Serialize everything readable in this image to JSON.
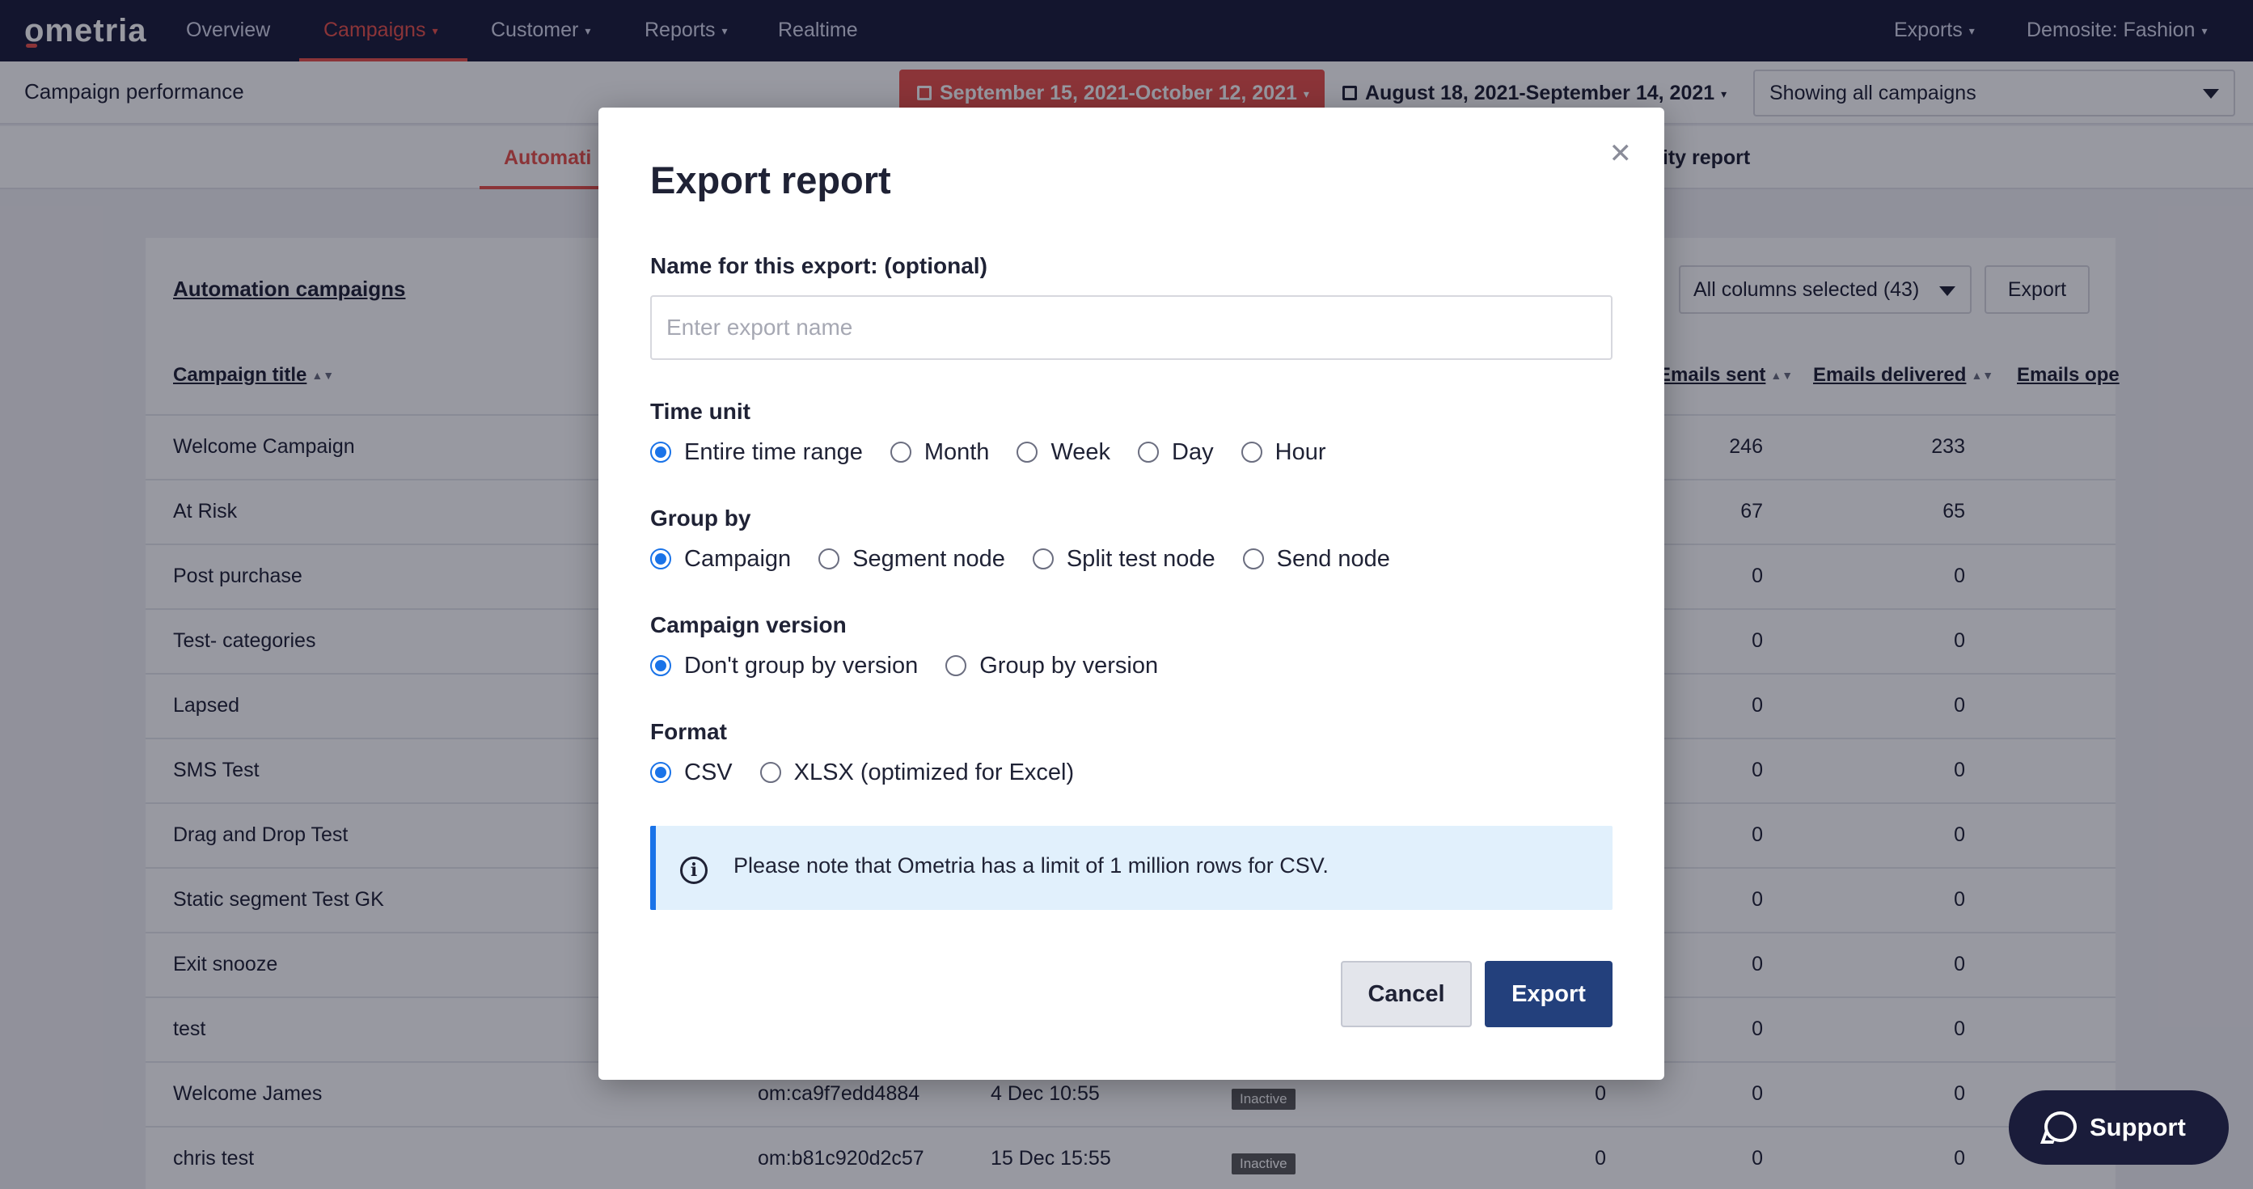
{
  "brand": {
    "logo": "ometria",
    "accent": "#e8524a",
    "nav_bg": "#1a1c3a",
    "primary_button": "#23407c"
  },
  "nav": {
    "items": [
      {
        "label": "Overview"
      },
      {
        "label": "Campaigns",
        "active": true
      },
      {
        "label": "Customer"
      },
      {
        "label": "Reports"
      },
      {
        "label": "Realtime"
      }
    ],
    "right": {
      "exports": "Exports",
      "account": "Demosite: Fashion"
    }
  },
  "subheader": {
    "title": "Campaign performance",
    "date_range_primary": "September 15, 2021-October 12, 2021",
    "date_range_compare": "August 18, 2021-September 14, 2021",
    "campaign_filter": "Showing all campaigns"
  },
  "tabs": {
    "left": "Automati",
    "right": "ility report"
  },
  "table": {
    "title": "Automation campaigns",
    "columns_select": "All columns selected (43)",
    "export_label": "Export",
    "headers": {
      "campaign_title": "Campaign title",
      "emails_sent": "Emails sent",
      "emails_delivered": "Emails delivered",
      "emails_opened": "Emails ope"
    },
    "rows": [
      {
        "title": "Welcome Campaign",
        "sent": "246",
        "delivered": "233"
      },
      {
        "title": "At Risk",
        "sent": "67",
        "delivered": "65"
      },
      {
        "title": "Post purchase",
        "sent": "0",
        "delivered": "0"
      },
      {
        "title": "Test- categories",
        "sent": "0",
        "delivered": "0"
      },
      {
        "title": "Lapsed",
        "sent": "0",
        "delivered": "0"
      },
      {
        "title": "SMS Test",
        "sent": "0",
        "delivered": "0"
      },
      {
        "title": "Drag and Drop Test",
        "sent": "0",
        "delivered": "0"
      },
      {
        "title": "Static segment Test GK",
        "sent": "0",
        "delivered": "0"
      },
      {
        "title": "Exit snooze",
        "sent": "0",
        "delivered": "0"
      },
      {
        "title": "test",
        "sent": "0",
        "delivered": "0"
      },
      {
        "title": "Welcome James",
        "id": "om:ca9f7edd4884",
        "date": "4 Dec 10:55",
        "status": "Inactive",
        "col_a": "0",
        "sent": "0",
        "delivered": "0"
      },
      {
        "title": "chris test",
        "id": "om:b81c920d2c57",
        "date": "15 Dec 15:55",
        "status": "Inactive",
        "col_a": "0",
        "sent": "0",
        "delivered": "0"
      }
    ]
  },
  "modal": {
    "title": "Export report",
    "name_label": "Name for this export: (optional)",
    "name_value": "",
    "name_placeholder": "Enter export name",
    "time_unit": {
      "label": "Time unit",
      "options": [
        "Entire time range",
        "Month",
        "Week",
        "Day",
        "Hour"
      ],
      "selected": "Entire time range"
    },
    "group_by": {
      "label": "Group by",
      "options": [
        "Campaign",
        "Segment node",
        "Split test node",
        "Send node"
      ],
      "selected": "Campaign"
    },
    "campaign_version": {
      "label": "Campaign version",
      "options": [
        "Don't group by version",
        "Group by version"
      ],
      "selected": "Don't group by version"
    },
    "format": {
      "label": "Format",
      "options": [
        "CSV",
        "XLSX (optimized for Excel)"
      ],
      "selected": "CSV"
    },
    "notice": "Please note that Ometria has a limit of 1 million rows for CSV.",
    "cancel": "Cancel",
    "export": "Export"
  },
  "support": {
    "label": "Support"
  }
}
